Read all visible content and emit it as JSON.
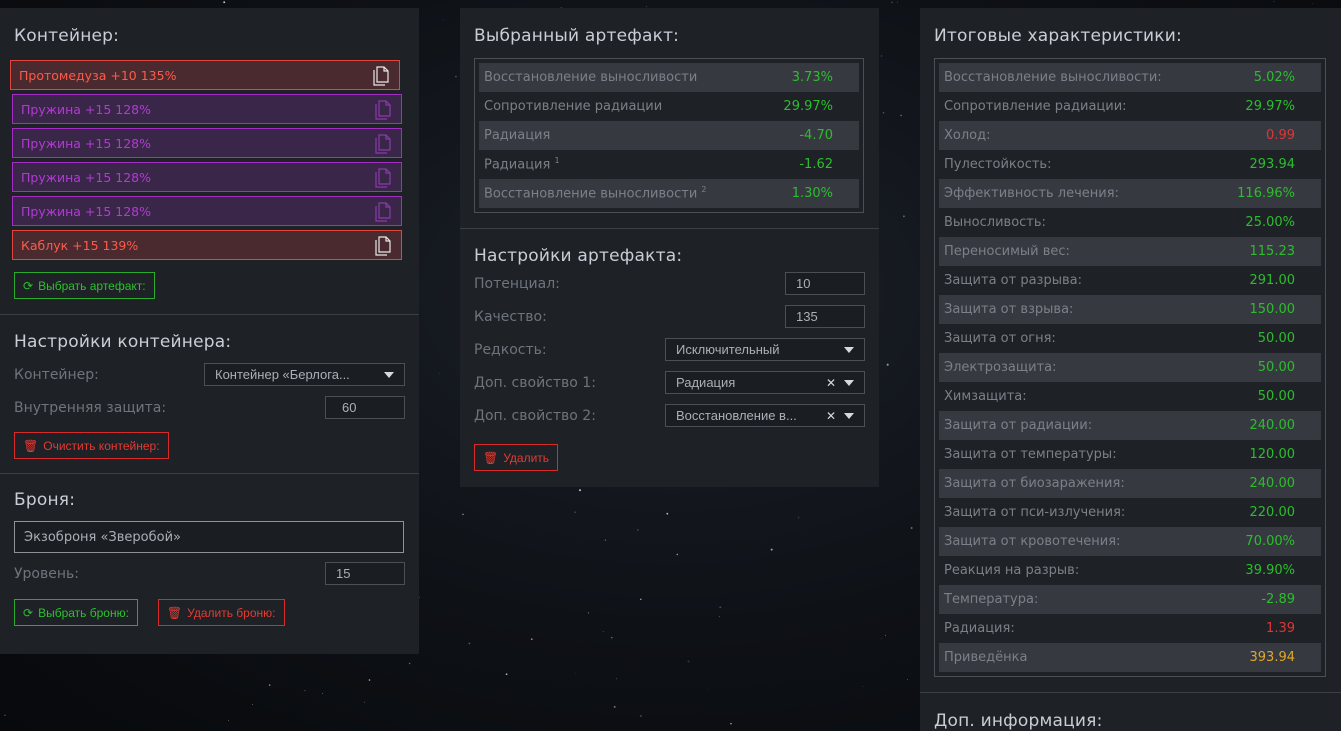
{
  "container_panel": {
    "title": "Контейнер:",
    "artifacts": [
      {
        "label": "Протомедуза +10 135%",
        "style": "red"
      },
      {
        "label": "Пружина +15 128%",
        "style": "purple"
      },
      {
        "label": "Пружина +15 128%",
        "style": "purple"
      },
      {
        "label": "Пружина +15 128%",
        "style": "purple"
      },
      {
        "label": "Пружина +15 128%",
        "style": "purple"
      },
      {
        "label": "Каблук +15 139%",
        "style": "red"
      }
    ],
    "select_artifact_button": "Выбрать артефакт:",
    "settings_title": "Настройки контейнера:",
    "container_label": "Контейнер:",
    "container_value": "Контейнер «Берлога...",
    "internal_protection_label": "Внутренняя защита:",
    "internal_protection_value": "60",
    "clear_button": "Очистить контейнер:",
    "armor_title": "Броня:",
    "armor_value": "Экзоброня «Зверобой»",
    "level_label": "Уровень:",
    "level_value": "15",
    "select_armor_button": "Выбрать броню:",
    "delete_armor_button": "Удалить броню:"
  },
  "artifact_panel": {
    "title": "Выбранный артефакт:",
    "stats": [
      {
        "label": "Восстановление выносливости",
        "sup": "",
        "value": "3.73%",
        "color": "green"
      },
      {
        "label": "Сопротивление радиации",
        "sup": "",
        "value": "29.97%",
        "color": "green"
      },
      {
        "label": "Радиация",
        "sup": "",
        "value": "-4.70",
        "color": "green"
      },
      {
        "label": "Радиация",
        "sup": "1",
        "value": "-1.62",
        "color": "green"
      },
      {
        "label": "Восстановление выносливости",
        "sup": "2",
        "value": "1.30%",
        "color": "green"
      }
    ],
    "settings_title": "Настройки артефакта:",
    "potential_label": "Потенциал:",
    "potential_value": "10",
    "quality_label": "Качество:",
    "quality_value": "135",
    "rarity_label": "Редкость:",
    "rarity_value": "Исключительный",
    "prop1_label": "Доп. свойство 1:",
    "prop1_value": "Радиация",
    "prop2_label": "Доп. свойство 2:",
    "prop2_value": "Восстановление в...",
    "delete_button": "Удалить"
  },
  "summary_panel": {
    "title": "Итоговые характеристики:",
    "stats": [
      {
        "label": "Восстановление выносливости:",
        "value": "5.02%",
        "color": "green"
      },
      {
        "label": "Сопротивление радиации:",
        "value": "29.97%",
        "color": "green"
      },
      {
        "label": "Холод:",
        "value": "0.99",
        "color": "red"
      },
      {
        "label": "Пулестойкость:",
        "value": "293.94",
        "color": "green"
      },
      {
        "label": "Эффективность лечения:",
        "value": "116.96%",
        "color": "green"
      },
      {
        "label": "Выносливость:",
        "value": "25.00%",
        "color": "green"
      },
      {
        "label": "Переносимый вес:",
        "value": "115.23",
        "color": "green"
      },
      {
        "label": "Защита от разрыва:",
        "value": "291.00",
        "color": "green"
      },
      {
        "label": "Защита от взрыва:",
        "value": "150.00",
        "color": "green"
      },
      {
        "label": "Защита от огня:",
        "value": "50.00",
        "color": "green"
      },
      {
        "label": "Электрозащита:",
        "value": "50.00",
        "color": "green"
      },
      {
        "label": "Химзащита:",
        "value": "50.00",
        "color": "green"
      },
      {
        "label": "Защита от радиации:",
        "value": "240.00",
        "color": "green"
      },
      {
        "label": "Защита от температуры:",
        "value": "120.00",
        "color": "green"
      },
      {
        "label": "Защита от биозаражения:",
        "value": "240.00",
        "color": "green"
      },
      {
        "label": "Защита от пси-излучения:",
        "value": "220.00",
        "color": "green"
      },
      {
        "label": "Защита от кровотечения:",
        "value": "70.00%",
        "color": "green"
      },
      {
        "label": "Реакция на разрыв:",
        "value": "39.90%",
        "color": "green"
      },
      {
        "label": "Температура:",
        "value": "-2.89",
        "color": "green"
      },
      {
        "label": "Радиация:",
        "value": "1.39",
        "color": "red"
      },
      {
        "label": "Приведёнка",
        "value": "393.94",
        "color": "gold"
      }
    ],
    "extra_info_title": "Доп. информация:"
  }
}
